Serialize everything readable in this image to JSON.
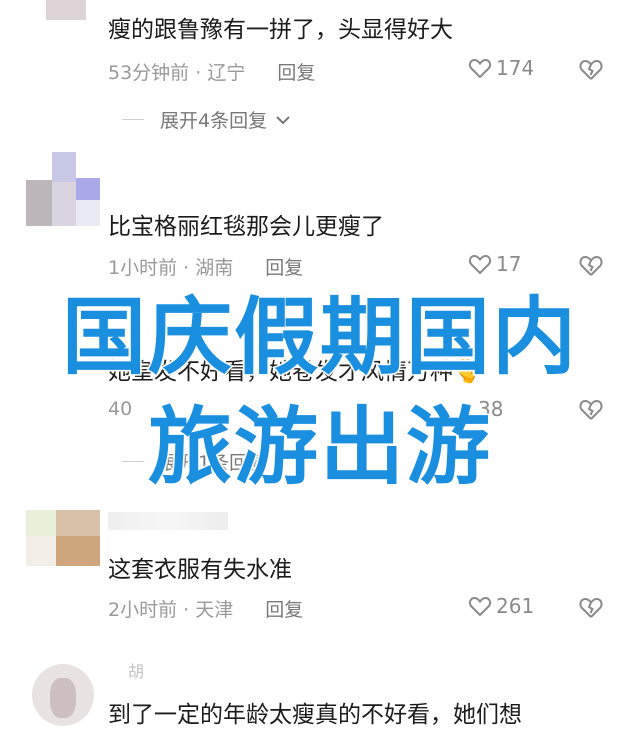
{
  "comments": [
    {
      "text": "瘦的跟鲁豫有一拼了，头显得好大",
      "time": "53分钟前",
      "location": "辽宁",
      "reply_label": "回复",
      "likes": "174",
      "expand_label": "展开4条回复"
    },
    {
      "text": "比宝格丽红毯那会儿更瘦了",
      "time": "1小时前",
      "location": "湖南",
      "reply_label": "回复",
      "likes": "17"
    },
    {
      "text": "她皇发不好看，她卷发才风情万种",
      "emoji": "🫰",
      "time": "40",
      "location": "",
      "reply_label": "",
      "likes": "38",
      "expand_label": "展开1条回复"
    },
    {
      "text": "这套衣服有失水准",
      "time": "2小时前",
      "location": "天津",
      "reply_label": "回复",
      "likes": "261"
    },
    {
      "text": "到了一定的年龄太瘦真的不好看，她们想",
      "username": "胡"
    }
  ],
  "overlay": {
    "line1": "国庆假期国内",
    "line2": "旅游出游"
  },
  "colors": {
    "overlay_text": "#1a8fe0",
    "meta_text": "#9a9a9a"
  },
  "icons": {
    "like": "heart-outline-icon",
    "dislike": "broken-heart-icon",
    "expand": "chevron-down-icon"
  }
}
